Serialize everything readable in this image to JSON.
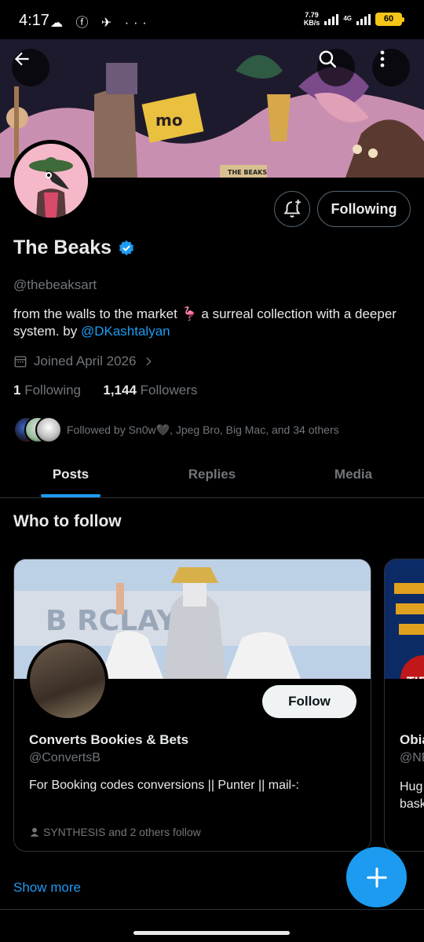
{
  "status_bar": {
    "time": "4:17",
    "notif_icons": "☁ ⓕ ✈ ···",
    "speed_value": "7.79",
    "speed_unit": "KB/s",
    "network": "4G",
    "battery": "60"
  },
  "header": {
    "back_icon": "arrow-left-icon",
    "search_icon": "search-icon",
    "more_icon": "more-vertical-icon"
  },
  "profile": {
    "name": "The Beaks",
    "verified_icon": "verified-badge-icon",
    "handle": "@thebeaksart",
    "bio_text": "from the walls to the market 🦩  a surreal collection with a deeper system. by ",
    "bio_link": "@DKashtalyan",
    "joined": "Joined April 2026",
    "following_count": "1",
    "following_label": "Following",
    "followers_count": "1,144",
    "followers_label": "Followers",
    "followed_by": "Followed by Sn0w🖤, Jpeg Bro, Big Mac, and 34 others",
    "following_button": "Following",
    "accent": "#1d9bf0"
  },
  "tabs": [
    {
      "label": "Posts",
      "active": true
    },
    {
      "label": "Replies",
      "active": false
    },
    {
      "label": "Media",
      "active": false
    }
  ],
  "who_to_follow": {
    "title": "Who to follow",
    "cards": [
      {
        "name": "Converts Bookies & Bets",
        "handle": "@ConvertsB",
        "bio": "For Booking codes conversions || Punter || mail-:",
        "followers": "SYNTHESIS and 2 others follow",
        "button": "Follow"
      },
      {
        "name": "Obia",
        "handle": "@NE",
        "bio_line1": "Hug",
        "bio_line2": "bask"
      }
    ],
    "show_more": "Show more"
  },
  "fab_icon": "plus-icon"
}
